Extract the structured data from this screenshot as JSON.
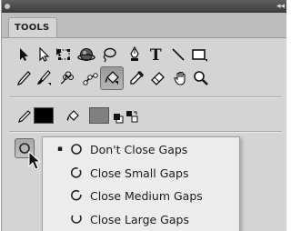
{
  "panel": {
    "tab_label": "TOOLS",
    "collapse_glyph": "◂◂"
  },
  "tools": {
    "row1": [
      "selection-tool",
      "subselection-tool",
      "free-transform-tool",
      "3d-rotation-tool",
      "lasso-tool",
      "pen-tool",
      "text-tool",
      "line-tool",
      "rectangle-tool"
    ],
    "row2": [
      "pencil-tool",
      "brush-tool",
      "deco-tool",
      "bone-tool",
      "paint-bucket-tool",
      "eyedropper-tool",
      "eraser-tool",
      "hand-tool",
      "zoom-tool"
    ],
    "active_tool": "paint-bucket-tool"
  },
  "colors": {
    "stroke_color": "#000000",
    "fill_color": "#808080"
  },
  "gap_menu": {
    "items": [
      {
        "label": "Don't Close Gaps",
        "icon": "gap-circle-none-icon",
        "checked": "▪"
      },
      {
        "label": "Close Small Gaps",
        "icon": "gap-circle-small-icon",
        "checked": ""
      },
      {
        "label": "Close Medium Gaps",
        "icon": "gap-circle-medium-icon",
        "checked": ""
      },
      {
        "label": "Close Large Gaps",
        "icon": "gap-circle-large-icon",
        "checked": ""
      }
    ]
  }
}
